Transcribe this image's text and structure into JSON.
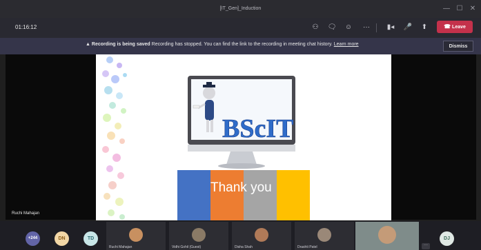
{
  "window": {
    "title": "[IT_Gen]_Induction",
    "min_icon": "—",
    "max_icon": "☐",
    "close_icon": "✕"
  },
  "toolbar": {
    "timer": "01:16:12",
    "people_icon": "⚇",
    "chat_icon": "🗨",
    "react_icon": "☺",
    "more_icon": "···",
    "camera_icon": "▮◂",
    "mic_icon": "🎤",
    "share_icon": "⬆",
    "leave_label": "Leave"
  },
  "banner": {
    "warning_icon": "▲",
    "bold_text": "Recording is being saved",
    "message": "Recording has stopped. You can find the link to the recording in meeting chat history.",
    "link": "Learn more",
    "dismiss_label": "Dismiss"
  },
  "slide": {
    "logo_text": "BScIT",
    "thank_you": "Thank you",
    "bar_colors": [
      "#4472c4",
      "#ed7d31",
      "#a5a5a5",
      "#ffc000"
    ]
  },
  "presenter_name": "Ruchi Mahajan",
  "participants": {
    "overflow_count": "+244",
    "avatars": [
      {
        "initials": "DN",
        "bg": "#f2d7a6",
        "fg": "#8a5a15"
      },
      {
        "initials": "TD",
        "bg": "#c8e6e8",
        "fg": "#2a6a70"
      }
    ],
    "tiles": [
      {
        "name": "Ruchi Mahajan"
      },
      {
        "name": "Vidhi Gohil (Guest)"
      },
      {
        "name": "Disha Shah"
      },
      {
        "name": "Drashti Patel"
      },
      {
        "name": ""
      }
    ],
    "last_avatar": {
      "initials": "DJ",
      "bg": "#dfe8e4",
      "fg": "#3c6b58"
    }
  }
}
